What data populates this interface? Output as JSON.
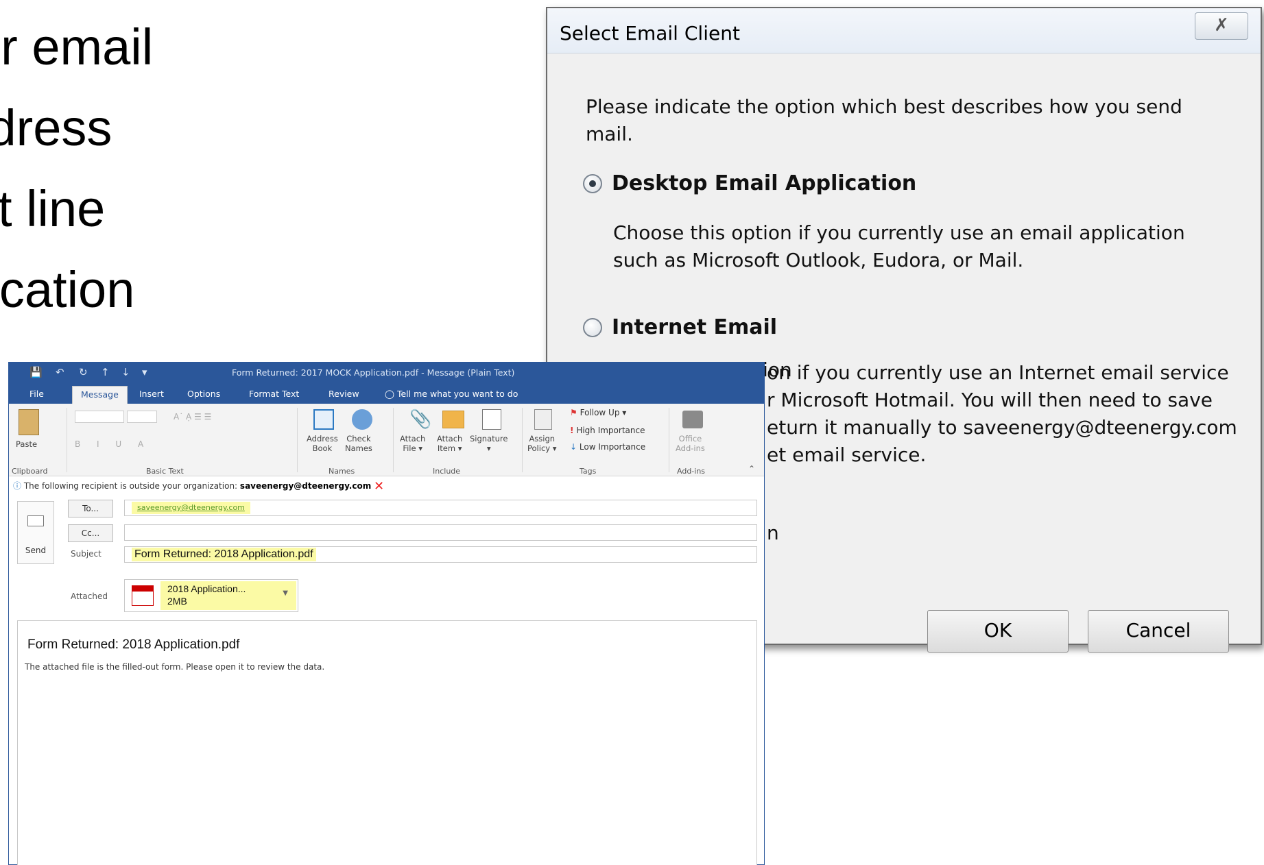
{
  "slide": {
    "lines": [
      "ur email",
      "ldress",
      "ct line",
      "lication"
    ]
  },
  "dialog": {
    "title": "Select Email Client",
    "close_glyph": "✗",
    "prompt": "Please indicate the option which best describes how you send mail.",
    "option_desktop": {
      "label": "Desktop Email Application",
      "description": "Choose this option if you currently use an email application such as Microsoft Outlook, Eudora, or Mail.",
      "selected": true
    },
    "option_internet": {
      "label": "Internet Email",
      "description_visible_parts": [
        "on if you currently use an Internet email service",
        "r Microsoft Hotmail. You will then need to save",
        "eturn it manually to saveenergy@dteenergy.com",
        "et email service."
      ],
      "description_partial_top": "Choose this option",
      "selected": false
    },
    "partial_text": "n",
    "ok_label": "OK",
    "cancel_label": "Cancel"
  },
  "outlook": {
    "window_title": "Form Returned: 2017 MOCK Application.pdf  -  Message (Plain Text)",
    "tabs": [
      "File",
      "Message",
      "Insert",
      "Options",
      "Format Text",
      "Review"
    ],
    "active_tab": "Message",
    "tell_me": "Tell me what you want to do",
    "ribbon": {
      "paste": "Paste",
      "address_book": [
        "Address",
        "Book"
      ],
      "check_names": [
        "Check",
        "Names"
      ],
      "attach_file": [
        "Attach",
        "File ▾"
      ],
      "attach_item": [
        "Attach",
        "Item ▾"
      ],
      "signature": [
        "Signature",
        "▾"
      ],
      "assign_policy": [
        "Assign",
        "Policy ▾"
      ],
      "follow_up": "Follow Up ▾",
      "high_importance": "High Importance",
      "low_importance": "Low Importance",
      "office_addins": [
        "Office",
        "Add-ins"
      ],
      "groups": [
        "Clipboard",
        "Basic Text",
        "Names",
        "Include",
        "Tags",
        "Add-ins"
      ]
    },
    "info_bar": {
      "text": "The following recipient is outside your organization:",
      "recipient": "saveenergy@dteenergy.com"
    },
    "send_label": "Send",
    "to_label": "To...",
    "cc_label": "Cc...",
    "to_value": "saveenergy@dteenergy.com",
    "subject_label": "Subject",
    "subject_value": "Form Returned: 2018 Application.pdf",
    "attached_label": "Attached",
    "attachment": {
      "name": "2018 Application...",
      "size": "2MB"
    },
    "body_heading": "Form Returned: 2018 Application.pdf",
    "body_text": "The attached file is the filled-out form. Please open it to review the data."
  },
  "colors": {
    "outlook_blue": "#2b579a",
    "highlight_yellow": "#fbfaa5",
    "dialog_bg": "#f0f0f0"
  }
}
